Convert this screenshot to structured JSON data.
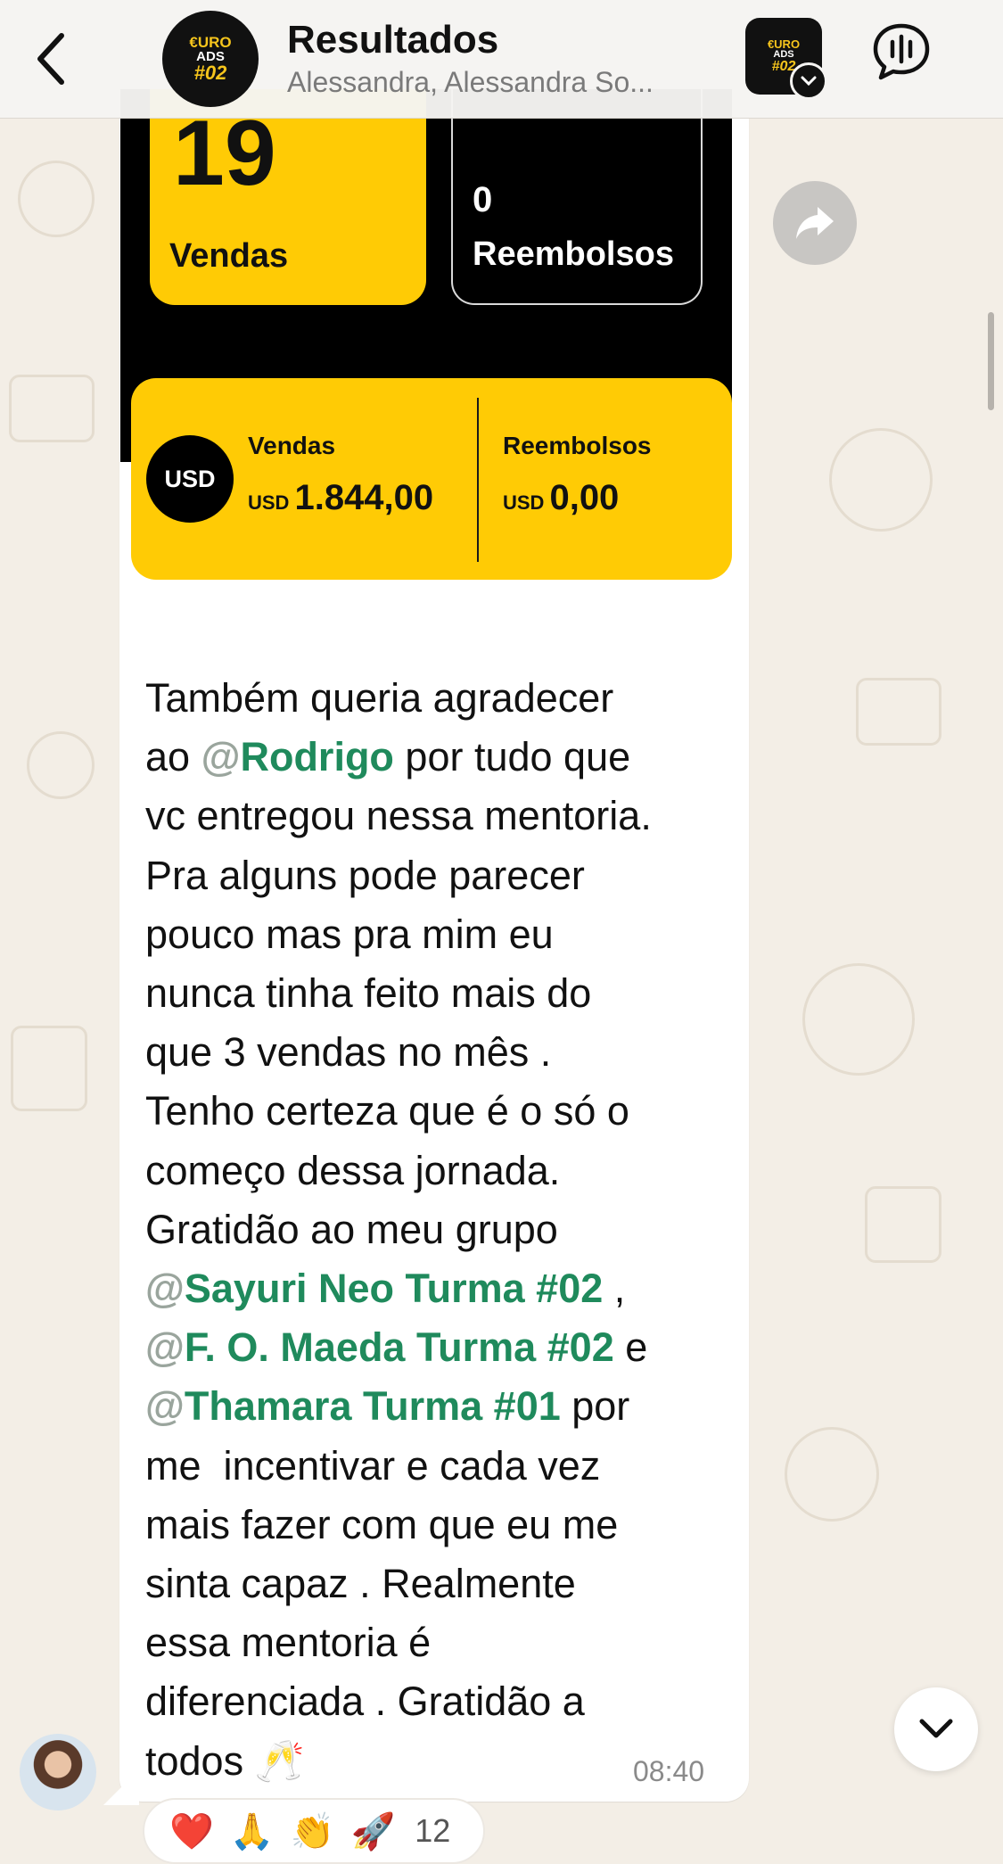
{
  "header": {
    "back_icon": "chevron-left-icon",
    "title": "Resultados",
    "subtitle": "Alessandra, Alessandra So...",
    "avatar_logo": {
      "line1": "€URO",
      "line2": "ADS",
      "line3": "#02"
    },
    "audio_icon": "waveform-icon"
  },
  "image": {
    "sales_count": "19",
    "sales_label": "Vendas",
    "refunds_count": "0",
    "refunds_label": "Reembolsos",
    "currency_badge": "USD",
    "sales_title": "Vendas",
    "sales_currency": "USD",
    "sales_amount": "1.844,00",
    "refunds_title": "Reembolsos",
    "refunds_currency": "USD",
    "refunds_amount": "0,00",
    "accent_color": "#ffcb05"
  },
  "message": {
    "line1": "Também queria agradecer",
    "line2_pre": "ao ",
    "mention1": "Rodrigo",
    "line2_post": " por tudo que",
    "line3": "vc entregou nessa mentoria.",
    "line4": "Pra alguns pode parecer",
    "line5": "pouco mas pra mim eu",
    "line6": "nunca tinha feito mais do",
    "line7": "que 3 vendas no mês .",
    "line8": "Tenho certeza que é o só o",
    "line9": "começo dessa jornada.",
    "line10": "Gratidão ao meu grupo",
    "mention2": "Sayuri Neo Turma #02",
    "mention2_post": " ,",
    "mention3": "F. O. Maeda Turma #02",
    "mention3_post": " e",
    "mention4": "Thamara Turma #01",
    "mention4_post": " por",
    "line14": "me  incentivar e cada vez",
    "line15": "mais fazer com que eu me",
    "line16": "sinta capaz . Realmente",
    "line17": "essa mentoria é",
    "line18": "diferenciada . Gratidão a",
    "line19": "todos 🥂",
    "time": "08:40",
    "mention_color": "#1f8a5c"
  },
  "reactions": {
    "emojis": [
      "❤️",
      "🙏",
      "👏",
      "🚀"
    ],
    "count": "12"
  },
  "icons": {
    "forward": "forward-arrow-icon",
    "scroll_down": "chevron-down-icon"
  }
}
